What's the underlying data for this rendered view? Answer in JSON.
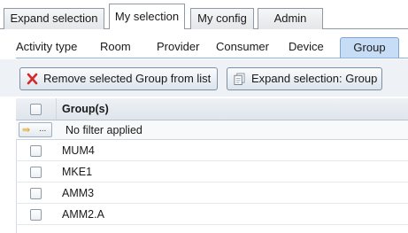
{
  "top_tabs": [
    {
      "label": "Expand selection",
      "active": false
    },
    {
      "label": "My selection",
      "active": true
    },
    {
      "label": "My config",
      "active": false
    },
    {
      "label": "Admin",
      "active": false
    }
  ],
  "sub_tabs": [
    {
      "label": "Activity type",
      "active": false
    },
    {
      "label": "Room",
      "active": false
    },
    {
      "label": "Provider",
      "active": false
    },
    {
      "label": "Consumer",
      "active": false
    },
    {
      "label": "Device",
      "active": false
    },
    {
      "label": "Group",
      "active": true
    }
  ],
  "toolbar": {
    "remove_label": "Remove selected Group from list",
    "expand_label": "Expand selection: Group",
    "remove_icon": "red-x-icon",
    "expand_icon": "document-icon"
  },
  "grid": {
    "header": "Group(s)",
    "filter_button": "...",
    "filter_text": "No filter applied",
    "rows": [
      "MUM4",
      "MKE1",
      "AMM3",
      "AMM2.A"
    ]
  },
  "colors": {
    "active_subtab": "#c7dcf5",
    "remove_icon": "#d4282a"
  }
}
